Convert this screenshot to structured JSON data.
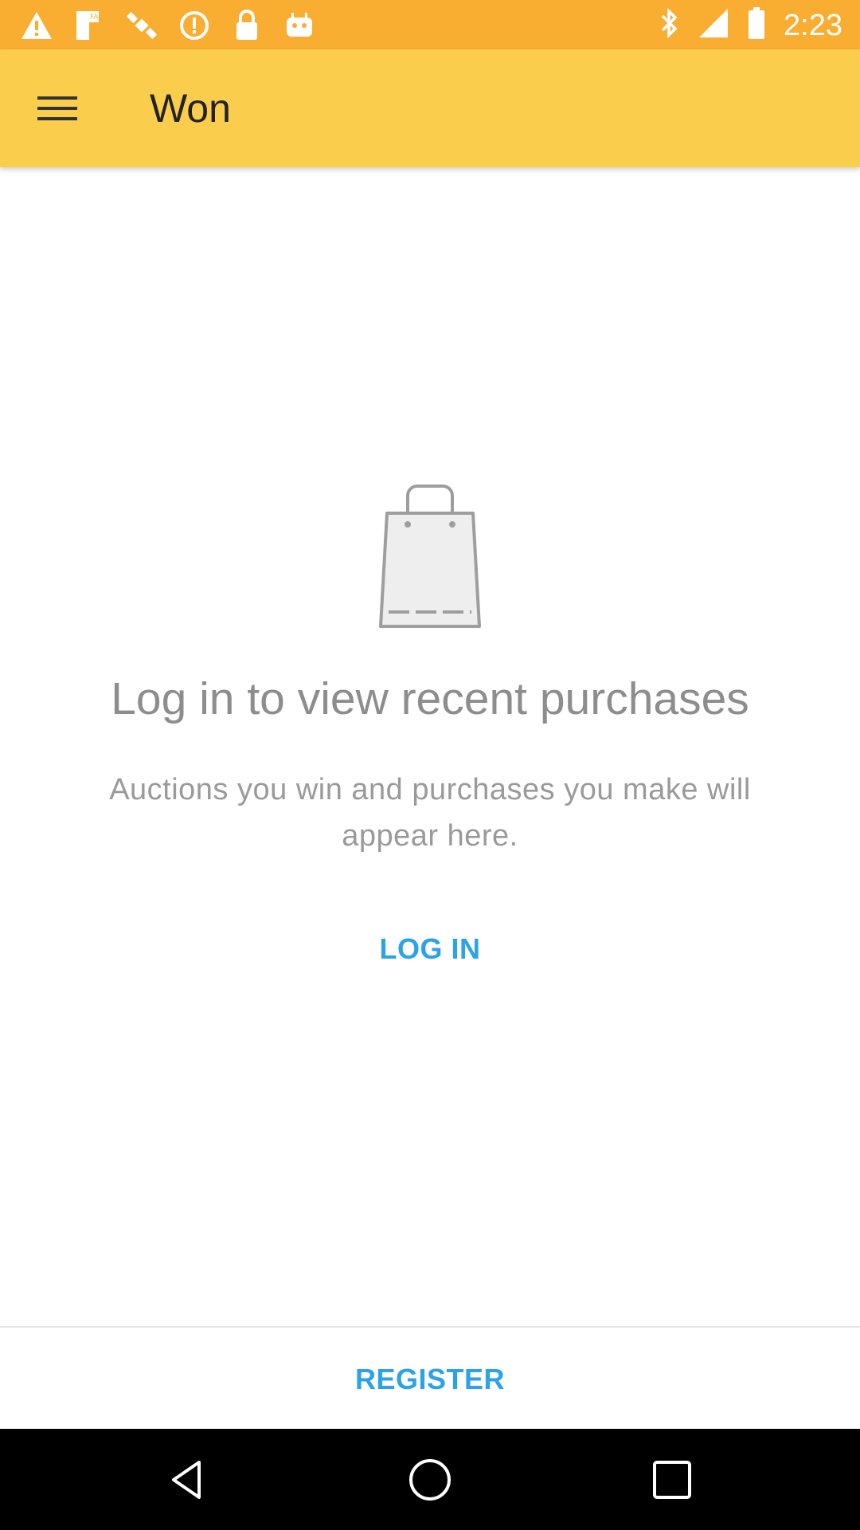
{
  "status_bar": {
    "time": "2:23",
    "icons": [
      "warning-icon",
      "fake-gps-icon",
      "satellite-icon",
      "info-icon",
      "lock-icon",
      "android-icon",
      "bluetooth-icon",
      "signal-icon",
      "battery-icon"
    ],
    "bg_color": "#F9AE32"
  },
  "app_bar": {
    "title": "Won",
    "bg_color": "#FBCD4C"
  },
  "empty_state": {
    "title": "Log in to view recent purchases",
    "subtitle": "Auctions you win and purchases you make will appear here.",
    "login_label": "LOG IN",
    "icon": "shopping-bag-icon"
  },
  "footer": {
    "register_label": "REGISTER",
    "link_color": "#2CA3E8"
  },
  "nav_bar": {
    "buttons": [
      "back-icon",
      "home-icon",
      "recents-icon"
    ]
  }
}
